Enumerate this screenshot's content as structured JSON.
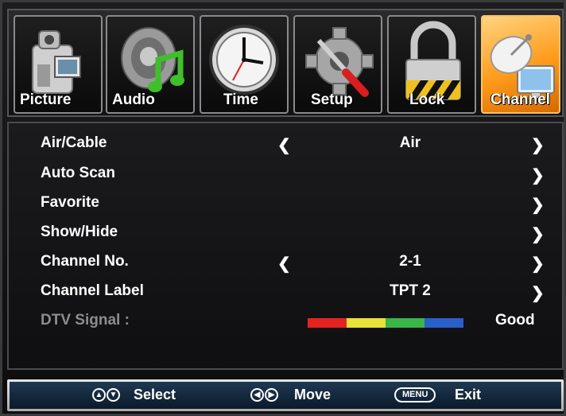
{
  "tabs": [
    {
      "label": "Picture",
      "icon": "camcorder-icon"
    },
    {
      "label": "Audio",
      "icon": "speaker-music-icon"
    },
    {
      "label": "Time",
      "icon": "clock-icon"
    },
    {
      "label": "Setup",
      "icon": "gear-tools-icon"
    },
    {
      "label": "Lock",
      "icon": "padlock-icon"
    },
    {
      "label": "Channel",
      "icon": "satellite-dish-icon",
      "active": true
    }
  ],
  "menu": {
    "air_cable": {
      "label": "Air/Cable",
      "value": "Air"
    },
    "auto_scan": {
      "label": "Auto Scan"
    },
    "favorite": {
      "label": "Favorite"
    },
    "show_hide": {
      "label": "Show/Hide"
    },
    "channel_no": {
      "label": "Channel No.",
      "value": "2-1"
    },
    "channel_label": {
      "label": "Channel Label",
      "value": "TPT 2"
    },
    "dtv_signal": {
      "label": "DTV Signal :",
      "value": "Good",
      "bar_colors": [
        "#e32322",
        "#e8e23a",
        "#39b54a",
        "#2a5fc9"
      ]
    }
  },
  "hints": {
    "select": "Select",
    "move": "Move",
    "menu_key": "MENU",
    "exit": "Exit"
  },
  "colors": {
    "active_tab": "#ff9a1a",
    "hint_bar": "#1e3852"
  }
}
